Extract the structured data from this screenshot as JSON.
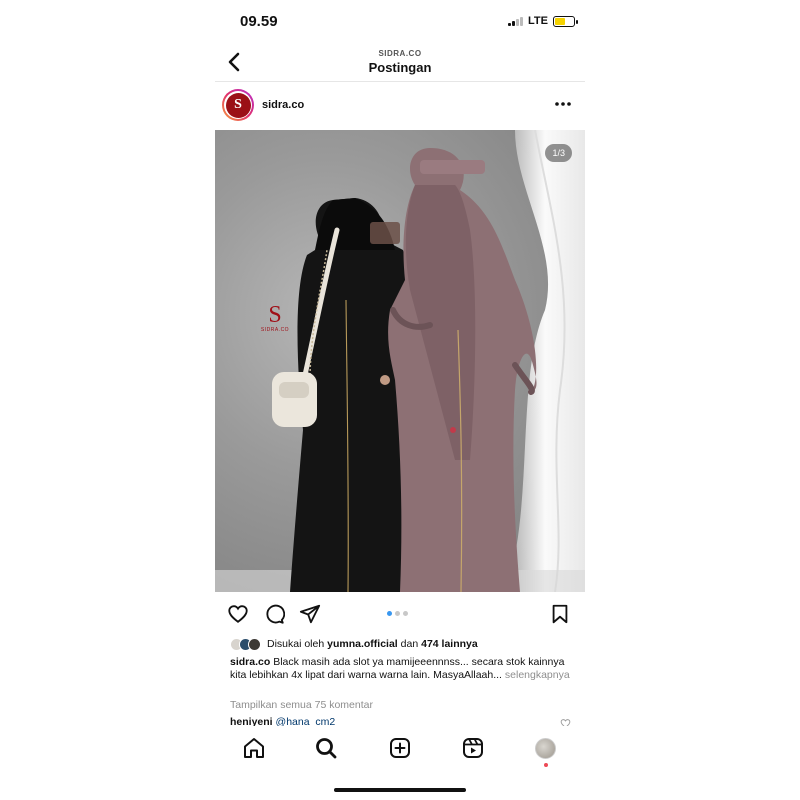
{
  "status_bar": {
    "time": "09.59",
    "network": "LTE",
    "battery_color": "#f5d300"
  },
  "header": {
    "subtitle": "SIDRA.CO",
    "title": "Postingan",
    "back_icon": "chevron-left-icon"
  },
  "post": {
    "avatar_letter": "S",
    "username": "sidra.co",
    "more_icon": "more-horizontal-icon",
    "slide_counter": "1/3",
    "current_slide": 1,
    "total_slides": 3,
    "watermark_letter": "S",
    "watermark_text": "SIDRA.CO"
  },
  "actions": {
    "like_icon": "heart-icon",
    "comment_icon": "comment-icon",
    "share_icon": "send-icon",
    "save_icon": "bookmark-icon"
  },
  "likes": {
    "prefix": "Disukai oleh",
    "user": "yumna.official",
    "connector": "dan",
    "count": "474 lainnya"
  },
  "caption": {
    "username": "sidra.co",
    "text": "Black masih ada slot ya mamijeeennnss... secara stok kainnya kita lebihkan 4x lipat dari warna warna lain. MasyaAllaah...",
    "more": "selengkapnya"
  },
  "comments": {
    "view_all": "Tampilkan semua 75 komentar",
    "preview_user": "heniyeni",
    "preview_mention": "@hana_cm2"
  },
  "tab_bar": {
    "items": [
      "home-icon",
      "search-icon",
      "create-icon",
      "reels-icon",
      "profile-avatar"
    ]
  },
  "colors": {
    "brand_red": "#9b1016",
    "link_blue": "#00376b",
    "dot_active": "#3897f0"
  }
}
